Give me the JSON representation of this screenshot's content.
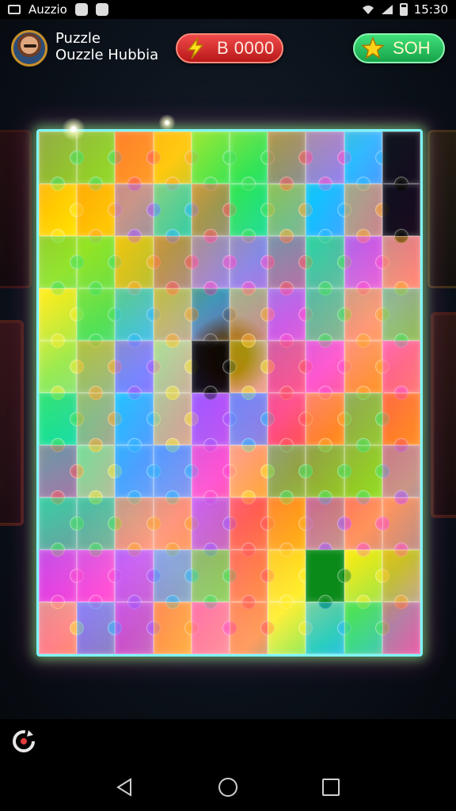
{
  "status_bar": {
    "left_text": "Auzzio",
    "time": "15:30"
  },
  "header": {
    "title": "Puzzle",
    "subtitle": "Ouzzle Hubbia",
    "coins_value": "B 0000",
    "stars_value": "SOH"
  },
  "board": {
    "columns": 10,
    "rows": 10,
    "piece_colors": [
      "#ff3240",
      "#ff9600",
      "#ffeb00",
      "#28dc46",
      "#00aaff",
      "#963cff",
      "#ff28c8"
    ]
  },
  "icons": {
    "coin": "lightning-bolt",
    "star": "star",
    "refresh": "refresh-arrows",
    "back": "triangle-left",
    "home": "circle",
    "recent": "square"
  },
  "colors": {
    "coin_pill": "#d92626",
    "star_pill": "#22c35e",
    "board_border": "#7df5ff"
  }
}
